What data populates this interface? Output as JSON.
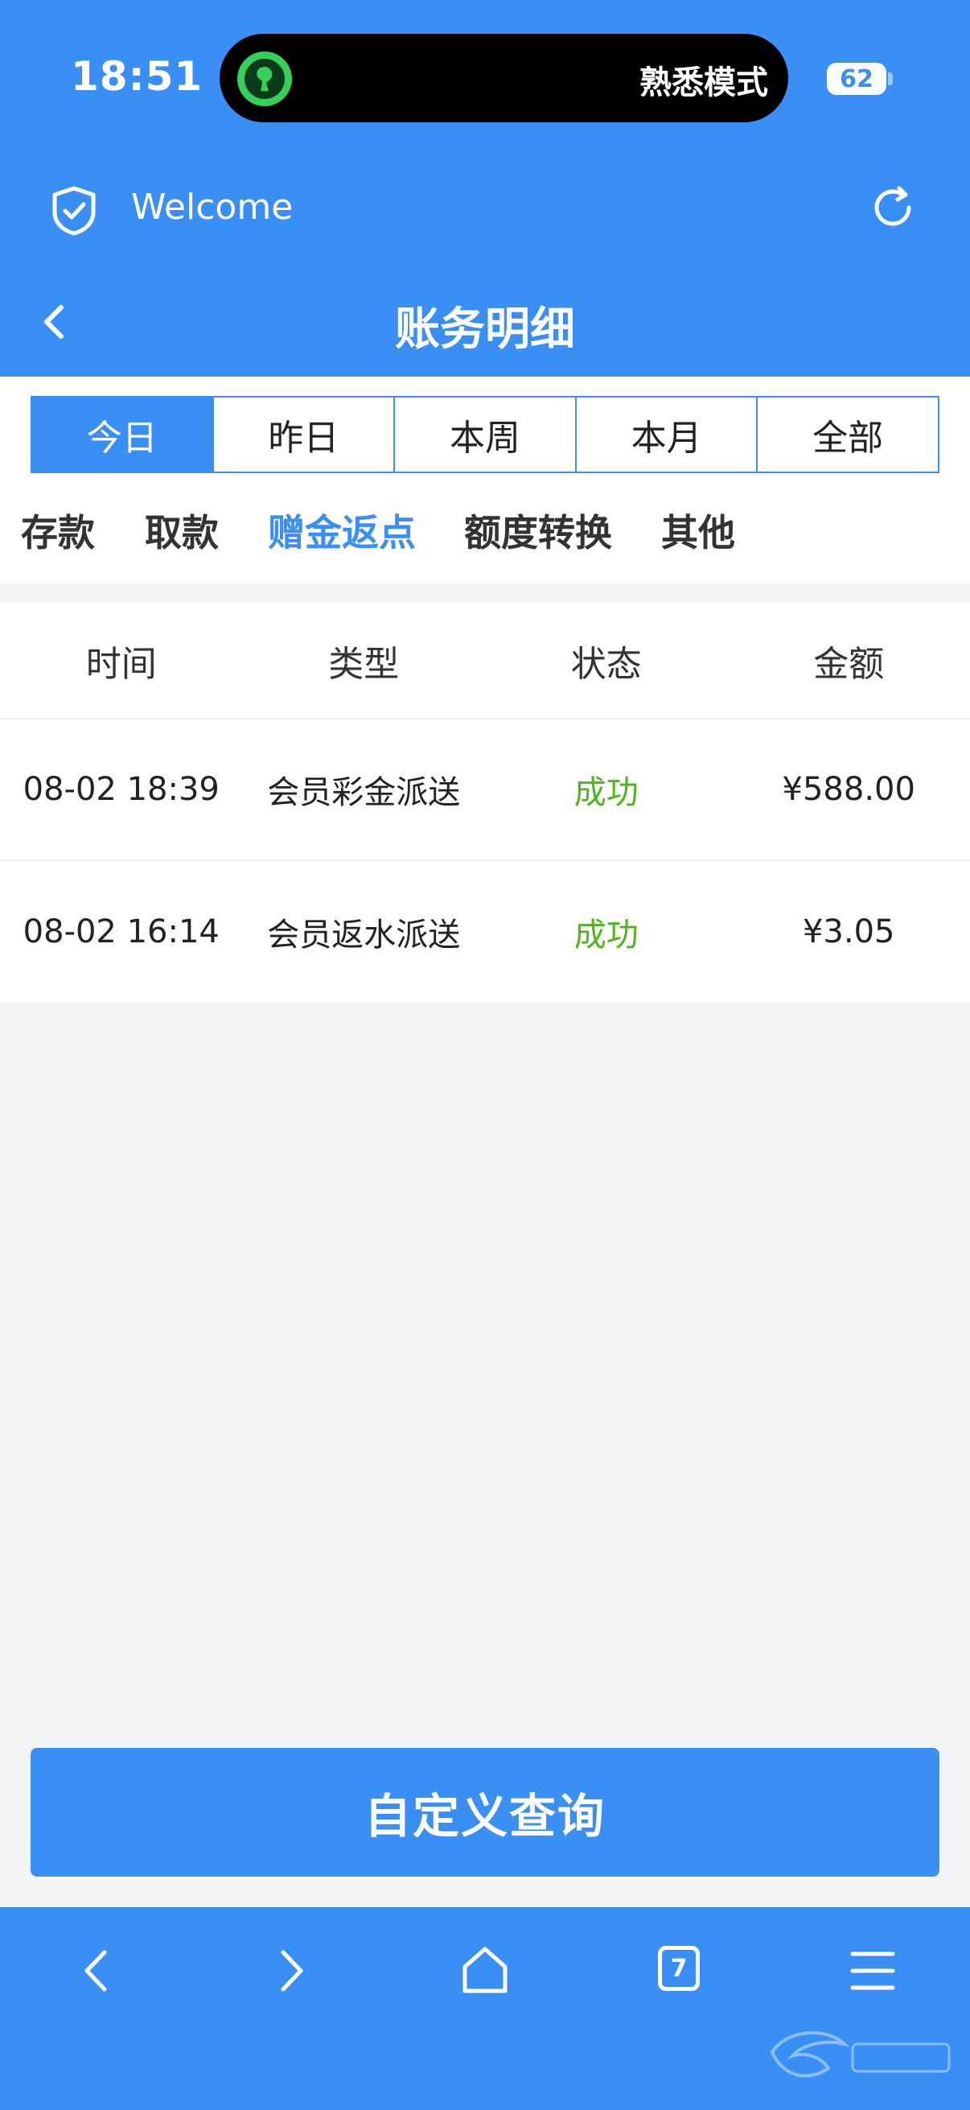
{
  "status_bar": {
    "time": "18:51",
    "island_label": "熟悉模式",
    "battery": "62"
  },
  "browser": {
    "site_title": "Welcome"
  },
  "nav": {
    "title": "账务明细"
  },
  "period_tabs": [
    {
      "label": "今日",
      "active": true
    },
    {
      "label": "昨日",
      "active": false
    },
    {
      "label": "本周",
      "active": false
    },
    {
      "label": "本月",
      "active": false
    },
    {
      "label": "全部",
      "active": false
    }
  ],
  "category_tabs": [
    {
      "label": "存款",
      "active": false
    },
    {
      "label": "取款",
      "active": false
    },
    {
      "label": "赠金返点",
      "active": true
    },
    {
      "label": "额度转换",
      "active": false
    },
    {
      "label": "其他",
      "active": false
    }
  ],
  "table": {
    "headers": [
      "时间",
      "类型",
      "状态",
      "金额"
    ],
    "rows": [
      {
        "time": "08-02 18:39",
        "type": "会员彩金派送",
        "status": "成功",
        "amount": "¥588.00"
      },
      {
        "time": "08-02 16:14",
        "type": "会员返水派送",
        "status": "成功",
        "amount": "¥3.05"
      }
    ]
  },
  "query_button": "自定义查询",
  "bottom_bar": {
    "tab_count": "7",
    "icons": [
      "back-icon",
      "forward-icon",
      "home-icon",
      "tabs-icon",
      "menu-icon"
    ]
  },
  "colors": {
    "accent": "#3a8ff5",
    "success": "#52b41b",
    "background": "#f3f4f6"
  }
}
